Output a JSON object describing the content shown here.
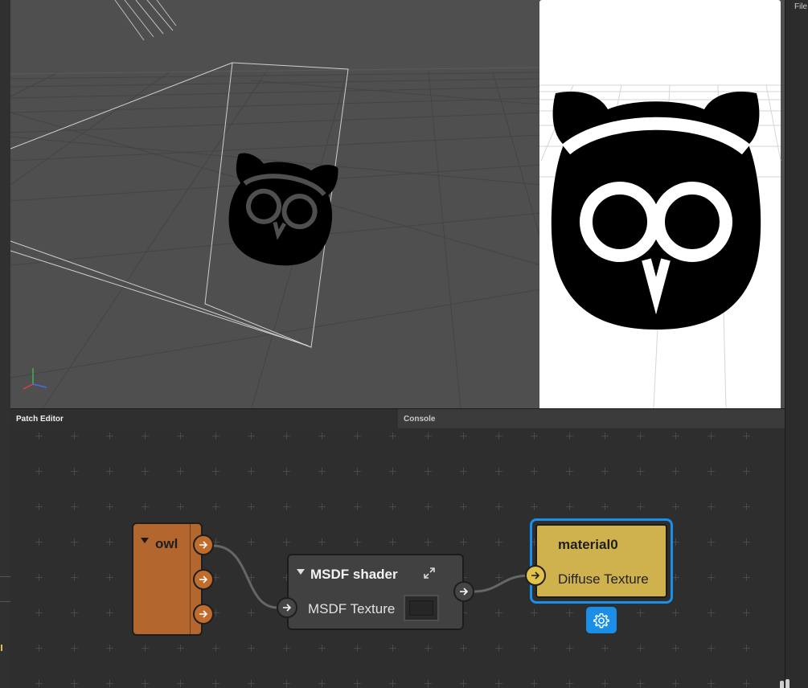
{
  "menu": {
    "file": "File"
  },
  "tabs": {
    "patch_editor": "Patch Editor",
    "console": "Console"
  },
  "nodes": {
    "owl": {
      "title": "owl",
      "color": "#b3672e"
    },
    "msdf_shader": {
      "title": "MSDF shader",
      "input_label": "MSDF Texture"
    },
    "material": {
      "title": "material0",
      "input_label": "Diffuse Texture",
      "color": "#cfb14e"
    }
  },
  "colors": {
    "selection": "#1b8fe8",
    "accent": "#d8c04a"
  },
  "icons": [
    "owl-logo-icon",
    "arrow-right-icon",
    "expand-icon",
    "gear-icon",
    "axis-gizmo-icon",
    "light-arrows-icon"
  ]
}
